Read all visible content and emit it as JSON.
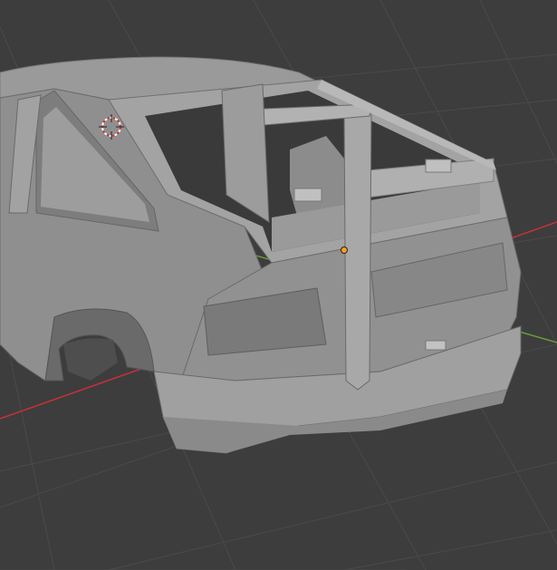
{
  "viewport": {
    "background_color": "#3d3d3d",
    "grid_color": "#4a4a4a",
    "x_axis_color": "#c8303a",
    "y_axis_color": "#6e9a3c",
    "model_color": "#8f8f8f",
    "model_shadow_color": "#6a6a6a",
    "model_highlight_color": "#b4b4b4",
    "origin_color": "#ff9e21"
  },
  "icons": {
    "cursor": "3d-cursor-icon",
    "origin": "object-origin-icon"
  }
}
